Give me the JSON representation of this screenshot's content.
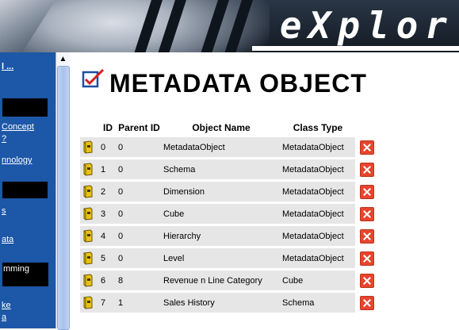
{
  "banner": {
    "text": "eXplor"
  },
  "sidebar": {
    "links": [
      "l ...",
      "Concept",
      "?",
      "nnology",
      "s",
      "ata",
      "ke",
      "a"
    ],
    "blocks": [
      "",
      "",
      "mming"
    ]
  },
  "page": {
    "title": "METADATA OBJECT"
  },
  "table": {
    "headers": {
      "id": "ID",
      "parent_id": "Parent ID",
      "object_name": "Object Name",
      "class_type": "Class Type"
    },
    "rows": [
      {
        "id": "0",
        "parent_id": "0",
        "object_name": "MetadataObject",
        "class_type": "MetadataObject"
      },
      {
        "id": "1",
        "parent_id": "0",
        "object_name": "Schema",
        "class_type": "MetadataObject"
      },
      {
        "id": "2",
        "parent_id": "0",
        "object_name": "Dimension",
        "class_type": "MetadataObject"
      },
      {
        "id": "3",
        "parent_id": "0",
        "object_name": "Cube",
        "class_type": "MetadataObject"
      },
      {
        "id": "4",
        "parent_id": "0",
        "object_name": "Hierarchy",
        "class_type": "MetadataObject"
      },
      {
        "id": "5",
        "parent_id": "0",
        "object_name": "Level",
        "class_type": "MetadataObject"
      },
      {
        "id": "6",
        "parent_id": "8",
        "object_name": "Revenue n Line Category",
        "class_type": "Cube"
      },
      {
        "id": "7",
        "parent_id": "1",
        "object_name": "Sales History",
        "class_type": "Schema"
      }
    ]
  },
  "colors": {
    "sidebar": "#1d57a8",
    "row": "#e6e6e6",
    "delete": "#e8452c"
  }
}
